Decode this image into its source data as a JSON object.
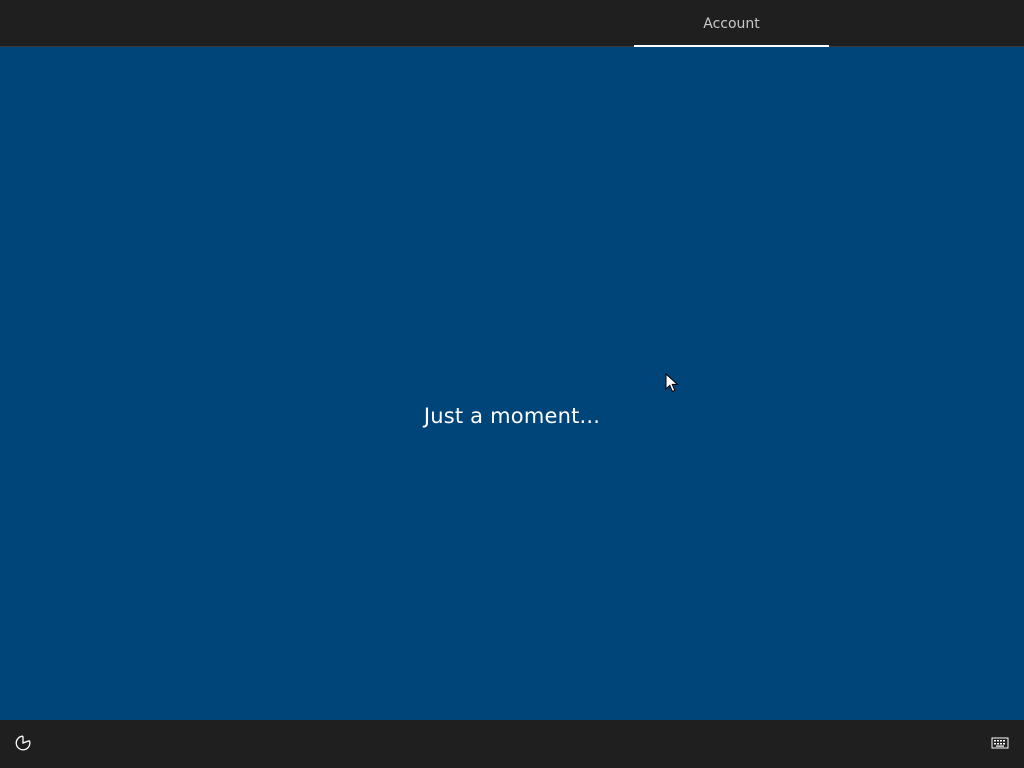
{
  "header": {
    "tabs": [
      {
        "label": "Account",
        "active": true
      }
    ]
  },
  "main": {
    "status_text": "Just a moment..."
  },
  "footer": {
    "left_icon": "ease-of-access-icon",
    "right_icon": "keyboard-icon"
  },
  "colors": {
    "background": "#00457a",
    "bars": "#1f1f1f",
    "tab_text": "#c8c8c8",
    "text": "#ffffff"
  }
}
